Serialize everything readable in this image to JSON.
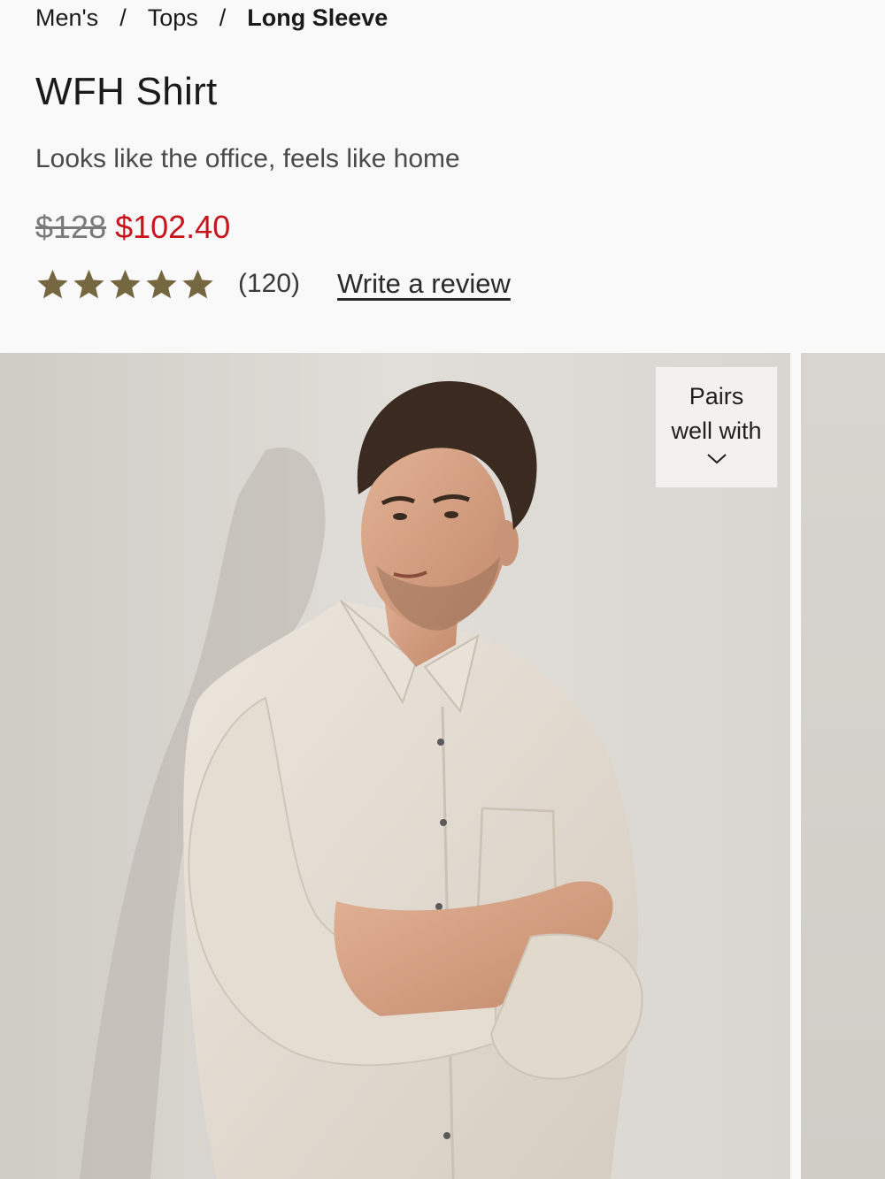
{
  "breadcrumb": {
    "items": [
      "Men's",
      "Tops"
    ],
    "separator": "/",
    "current": "Long Sleeve"
  },
  "product": {
    "title": "WFH Shirt",
    "subtitle": "Looks like the office, feels like home",
    "price_original": "$128",
    "price_sale": "$102.40",
    "rating": 5,
    "rating_max": 5,
    "review_count": "(120)",
    "write_review": "Write a review"
  },
  "gallery": {
    "pairs_line1": "Pairs",
    "pairs_line2": "well with",
    "pairs_icon": "chevron-down-icon"
  },
  "colors": {
    "sale_price": "#c8141c",
    "star": "#75673f",
    "photo_background": "#dcd9d4",
    "shirt": "#e4dcd2"
  }
}
